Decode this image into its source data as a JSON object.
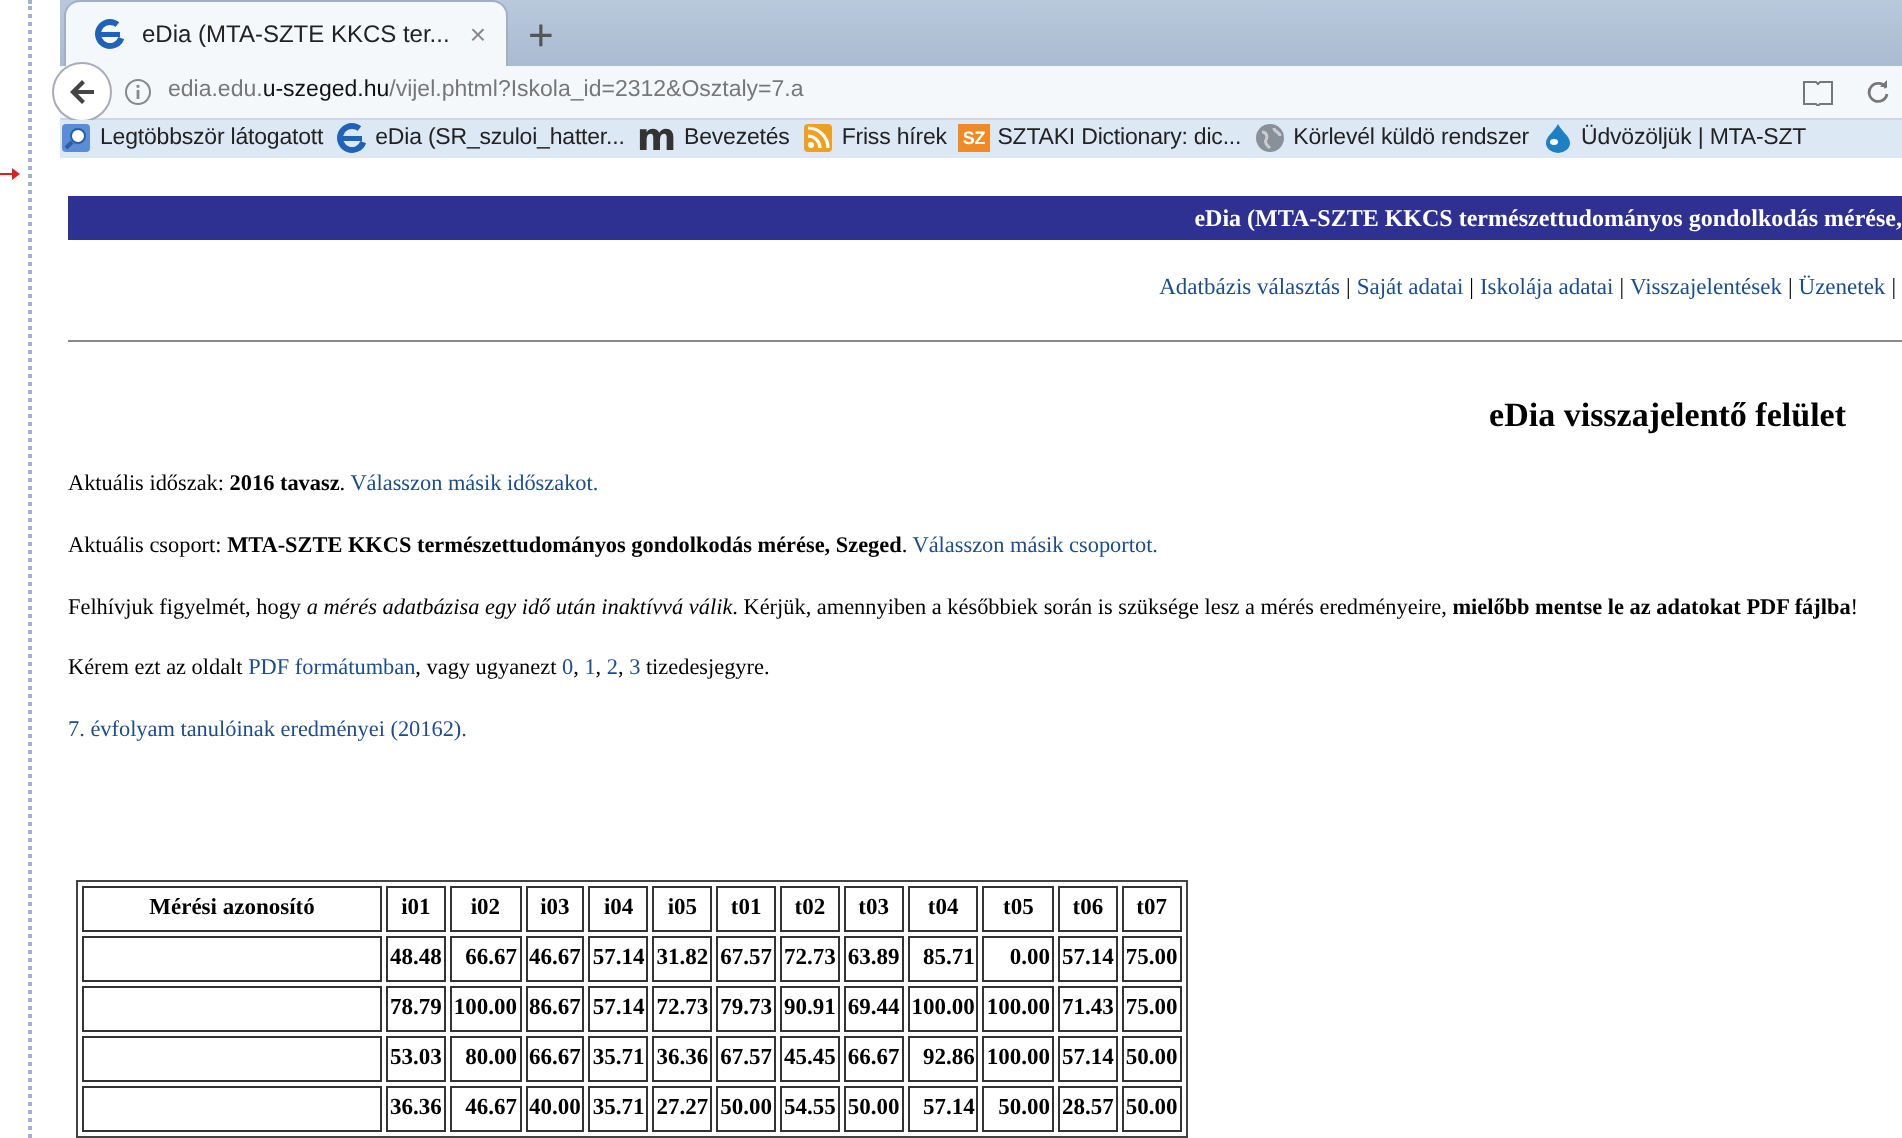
{
  "browser": {
    "tab": {
      "title": "eDia (MTA-SZTE KKCS ter...",
      "close": "×",
      "selected": true
    },
    "new_tab": "+",
    "url": {
      "host_prefix": "edia.edu.",
      "host": "u-szeged.hu",
      "path": "/vijel.phtml?Iskola_id=2312&Osztaly=7.a"
    },
    "bookmarks": [
      {
        "kind": "search",
        "label": "Legtöbbször látogatott"
      },
      {
        "kind": "edia",
        "label": "eDia (SR_szuloi_hatter..."
      },
      {
        "kind": "m",
        "icon_text": "m",
        "label": "Bevezetés"
      },
      {
        "kind": "rss",
        "label": "Friss hírek"
      },
      {
        "kind": "sz",
        "icon_text": "SZ",
        "label": "SZTAKI Dictionary: dic..."
      },
      {
        "kind": "globe",
        "label": "Körlevél küldö rendszer"
      },
      {
        "kind": "drop",
        "label": "Üdvözöljük | MTA-SZT"
      }
    ]
  },
  "page": {
    "header": "eDia (MTA-SZTE KKCS természettudományos gondolkodás mérése,",
    "nav": [
      {
        "kind": "link",
        "label": "Adatbázis választás"
      },
      {
        "kind": "sep",
        "label": "|"
      },
      {
        "kind": "link",
        "label": "Saját adatai"
      },
      {
        "kind": "sep",
        "label": "|"
      },
      {
        "kind": "link",
        "label": "Iskolája adatai"
      },
      {
        "kind": "sep",
        "label": "|"
      },
      {
        "kind": "link",
        "label": "Visszajelentések"
      },
      {
        "kind": "sep",
        "label": "|"
      },
      {
        "kind": "link",
        "label": "Üzenetek"
      },
      {
        "kind": "sep",
        "label": "|"
      }
    ],
    "title": "eDia visszajelentő felület",
    "paragraphs": [
      [
        {
          "kind": "text",
          "text": "Aktuális időszak: **2016 tavasz**. "
        },
        {
          "kind": "link",
          "text": "Válasszon másik időszakot."
        }
      ],
      [
        {
          "kind": "text",
          "text": "Aktuális csoport: **MTA-SZTE KKCS természettudományos gondolkodás mérése, Szeged**. "
        },
        {
          "kind": "link",
          "text": "Válasszon másik csoportot."
        }
      ],
      [
        {
          "kind": "text",
          "text": "Felhívjuk figyelmét, hogy *a mérés adatbázisa egy idő után inaktívvá válik*. Kérjük, amennyiben a későbbiek során is szüksége lesz a mérés eredményeire, **mielőbb mentse le az adatokat PDF fájlba**!"
        }
      ],
      [
        {
          "kind": "text",
          "text": "Kérem ezt az oldalt "
        },
        {
          "kind": "link",
          "text": "PDF formátumban"
        },
        {
          "kind": "text",
          "text": ", vagy ugyanezt "
        },
        {
          "kind": "link",
          "text": "0"
        },
        {
          "kind": "text",
          "text": ", "
        },
        {
          "kind": "link",
          "text": "1"
        },
        {
          "kind": "text",
          "text": ", "
        },
        {
          "kind": "link",
          "text": "2"
        },
        {
          "kind": "text",
          "text": ", "
        },
        {
          "kind": "link",
          "text": "3"
        },
        {
          "kind": "text",
          "text": " tizedesjegyre."
        }
      ],
      [
        {
          "kind": "link",
          "text": "7. évfolyam tanulóinak eredményei (20162)."
        }
      ]
    ],
    "table": {
      "columns": [
        "Mérési azonosító",
        "i01",
        "i02",
        "i03",
        "i04",
        "i05",
        "t01",
        "t02",
        "t03",
        "t04",
        "t05",
        "t06",
        "t07"
      ],
      "rows": [
        [
          "",
          "48.48",
          "66.67",
          "46.67",
          "57.14",
          "31.82",
          "67.57",
          "72.73",
          "63.89",
          "85.71",
          "0.00",
          "57.14",
          "75.00"
        ],
        [
          "",
          "78.79",
          "100.00",
          "86.67",
          "57.14",
          "72.73",
          "79.73",
          "90.91",
          "69.44",
          "100.00",
          "100.00",
          "71.43",
          "75.00"
        ],
        [
          "",
          "53.03",
          "80.00",
          "66.67",
          "35.71",
          "36.36",
          "67.57",
          "45.45",
          "66.67",
          "92.86",
          "100.00",
          "57.14",
          "50.00"
        ],
        [
          "",
          "36.36",
          "46.67",
          "40.00",
          "35.71",
          "27.27",
          "50.00",
          "54.55",
          "50.00",
          "57.14",
          "50.00",
          "28.57",
          "50.00"
        ]
      ]
    }
  }
}
